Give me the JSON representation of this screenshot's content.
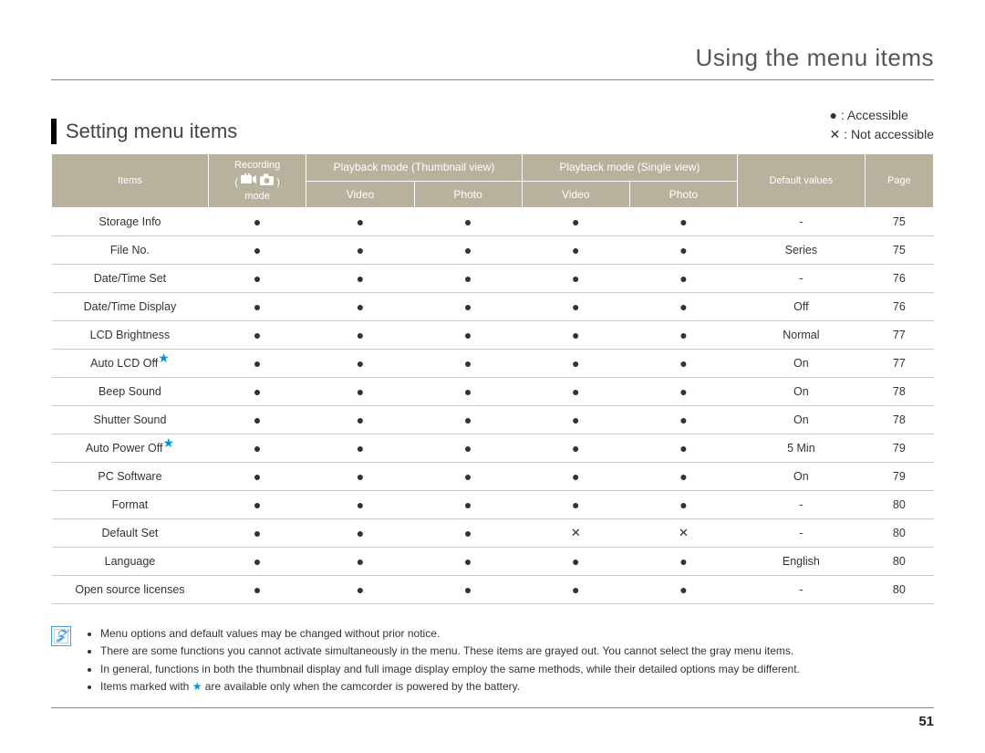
{
  "page_title": "Using the menu items",
  "section_title": "Setting menu items",
  "legend": {
    "accessible_symbol": "●",
    "accessible_label": " : Accessible",
    "not_accessible_symbol": "✕",
    "not_accessible_label": " : Not accessible"
  },
  "headers": {
    "items": "Items",
    "recording_top": "Recording",
    "recording_bottom": "mode",
    "thumb": "Playback mode (Thumbnail view)",
    "single": "Playback mode (Single view)",
    "video": "Video",
    "photo": "Photo",
    "defaults": "Default values",
    "page": "Page"
  },
  "rows": [
    {
      "item": "Storage Info",
      "star": false,
      "c1": "●",
      "c2": "●",
      "c3": "●",
      "c4": "●",
      "c5": "●",
      "def": "-",
      "page": "75"
    },
    {
      "item": "File No.",
      "star": false,
      "c1": "●",
      "c2": "●",
      "c3": "●",
      "c4": "●",
      "c5": "●",
      "def": "Series",
      "page": "75"
    },
    {
      "item": "Date/Time Set",
      "star": false,
      "c1": "●",
      "c2": "●",
      "c3": "●",
      "c4": "●",
      "c5": "●",
      "def": "-",
      "page": "76"
    },
    {
      "item": "Date/Time Display",
      "star": false,
      "c1": "●",
      "c2": "●",
      "c3": "●",
      "c4": "●",
      "c5": "●",
      "def": "Off",
      "page": "76"
    },
    {
      "item": "LCD Brightness",
      "star": false,
      "c1": "●",
      "c2": "●",
      "c3": "●",
      "c4": "●",
      "c5": "●",
      "def": "Normal",
      "page": "77"
    },
    {
      "item": "Auto LCD Off",
      "star": true,
      "c1": "●",
      "c2": "●",
      "c3": "●",
      "c4": "●",
      "c5": "●",
      "def": "On",
      "page": "77"
    },
    {
      "item": "Beep Sound",
      "star": false,
      "c1": "●",
      "c2": "●",
      "c3": "●",
      "c4": "●",
      "c5": "●",
      "def": "On",
      "page": "78"
    },
    {
      "item": "Shutter Sound",
      "star": false,
      "c1": "●",
      "c2": "●",
      "c3": "●",
      "c4": "●",
      "c5": "●",
      "def": "On",
      "page": "78"
    },
    {
      "item": "Auto Power Off",
      "star": true,
      "c1": "●",
      "c2": "●",
      "c3": "●",
      "c4": "●",
      "c5": "●",
      "def": "5 Min",
      "page": "79"
    },
    {
      "item": "PC Software",
      "star": false,
      "c1": "●",
      "c2": "●",
      "c3": "●",
      "c4": "●",
      "c5": "●",
      "def": "On",
      "page": "79"
    },
    {
      "item": "Format",
      "star": false,
      "c1": "●",
      "c2": "●",
      "c3": "●",
      "c4": "●",
      "c5": "●",
      "def": "-",
      "page": "80"
    },
    {
      "item": "Default Set",
      "star": false,
      "c1": "●",
      "c2": "●",
      "c3": "●",
      "c4": "✕",
      "c5": "✕",
      "def": "-",
      "page": "80"
    },
    {
      "item": "Language",
      "star": false,
      "c1": "●",
      "c2": "●",
      "c3": "●",
      "c4": "●",
      "c5": "●",
      "def": "English",
      "page": "80"
    },
    {
      "item": "Open source licenses",
      "star": false,
      "c1": "●",
      "c2": "●",
      "c3": "●",
      "c4": "●",
      "c5": "●",
      "def": "-",
      "page": "80"
    }
  ],
  "notes": [
    "Menu options and default values may be changed without prior notice.",
    "There are some functions you cannot activate simultaneously in the menu. These items are grayed out. You cannot select the gray menu items.",
    "In general, functions in both the thumbnail display and full image display employ the same methods, while their detailed options may be different.",
    "Items marked with ★ are available only when the camcorder is powered by the battery."
  ],
  "page_number": "51",
  "paren_open": "(",
  "paren_close": ")"
}
